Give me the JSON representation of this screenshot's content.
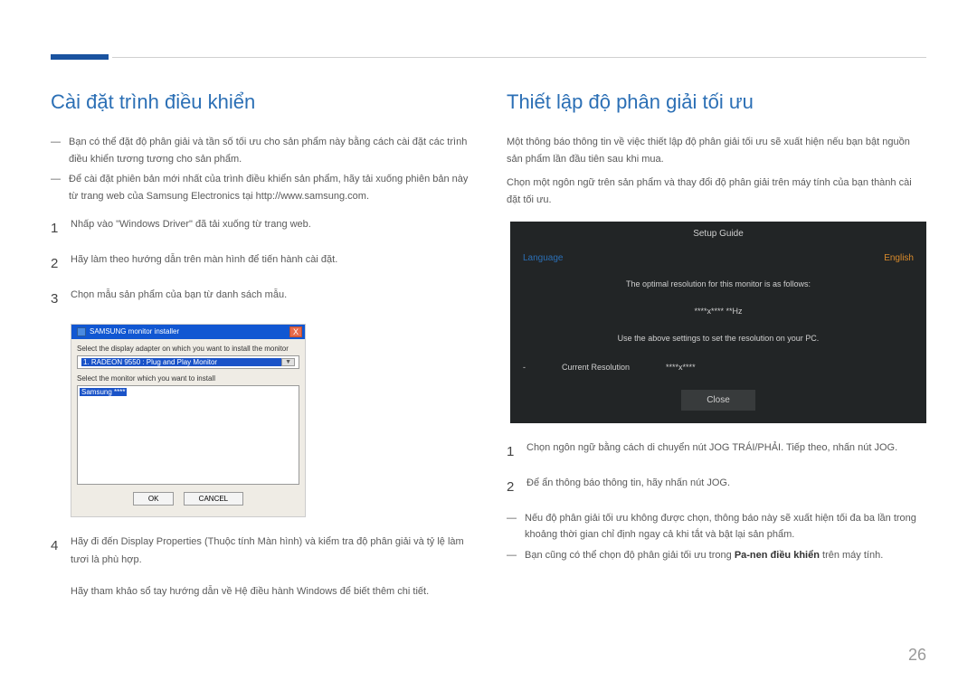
{
  "page_number": "26",
  "left": {
    "heading": "Cài đặt trình điều khiển",
    "notes": [
      "Bạn có thể đặt độ phân giải và tần số tối ưu cho sản phẩm này bằng cách cài đặt các trình điều khiển tương tương cho sản phẩm.",
      "Để cài đặt phiên bản mới nhất của trình điều khiển sản phẩm, hãy tải xuống phiên bản này từ trang web của Samsung Electronics tại http://www.samsung.com."
    ],
    "steps": [
      "Nhấp vào \"Windows Driver\" đã tải xuống từ trang web.",
      "Hãy làm theo hướng dẫn trên màn hình để tiến hành cài đặt.",
      "Chọn mẫu sản phẩm của bạn từ danh sách mẫu.",
      "Hãy đi đến Display Properties (Thuộc tính Màn hình) và kiểm tra độ phân giải và tỷ lệ làm tươi là phù hợp."
    ],
    "footnote": "Hãy tham khảo sổ tay hướng dẫn về Hệ điều hành Windows để biết thêm chi tiết.",
    "installer": {
      "title": "SAMSUNG monitor installer",
      "close_icon": "X",
      "label1": "Select the display adapter on which you want to install the monitor",
      "combo_selected": "1. RADEON 9550 : Plug and Play Monitor",
      "label2": "Select the monitor which you want to install",
      "list_selected": "Samsung ****",
      "btn_ok": "OK",
      "btn_cancel": "CANCEL"
    }
  },
  "right": {
    "heading": "Thiết lập độ phân giải tối ưu",
    "intro1": "Một thông báo thông tin về việc thiết lập độ phân giải tối ưu sẽ xuất hiện nếu bạn bật nguồn sản phẩm lần đầu tiên sau khi mua.",
    "intro2": "Chọn một ngôn ngữ trên sản phẩm và thay đổi độ phân giải trên máy tính của bạn thành cài đặt tối ưu.",
    "osd": {
      "title": "Setup Guide",
      "lang_label": "Language",
      "lang_value": "English",
      "line1": "The optimal resolution for this monitor is as follows:",
      "resolution_ph": "****x**** **Hz",
      "line2": "Use the above settings to set the resolution on your PC.",
      "current_dash": "-",
      "current_label": "Current Resolution",
      "current_value": "****x****",
      "close": "Close"
    },
    "steps": [
      "Chọn ngôn ngữ bằng cách di chuyển nút JOG TRÁI/PHẢI. Tiếp theo, nhấn nút JOG.",
      "Để ẩn thông báo thông tin, hãy nhấn nút JOG."
    ],
    "notes": [
      {
        "text_before": "Nếu độ phân giải tối ưu không được chọn, thông báo này sẽ xuất hiện tối đa ba lần trong khoảng thời gian chỉ định ngay cả khi tắt và bật lại sản phẩm."
      },
      {
        "text_before": "Bạn cũng có thể chọn độ phân giải tối ưu trong ",
        "bold": "Pa-nen điều khiển",
        "text_after": " trên máy tính."
      }
    ]
  }
}
